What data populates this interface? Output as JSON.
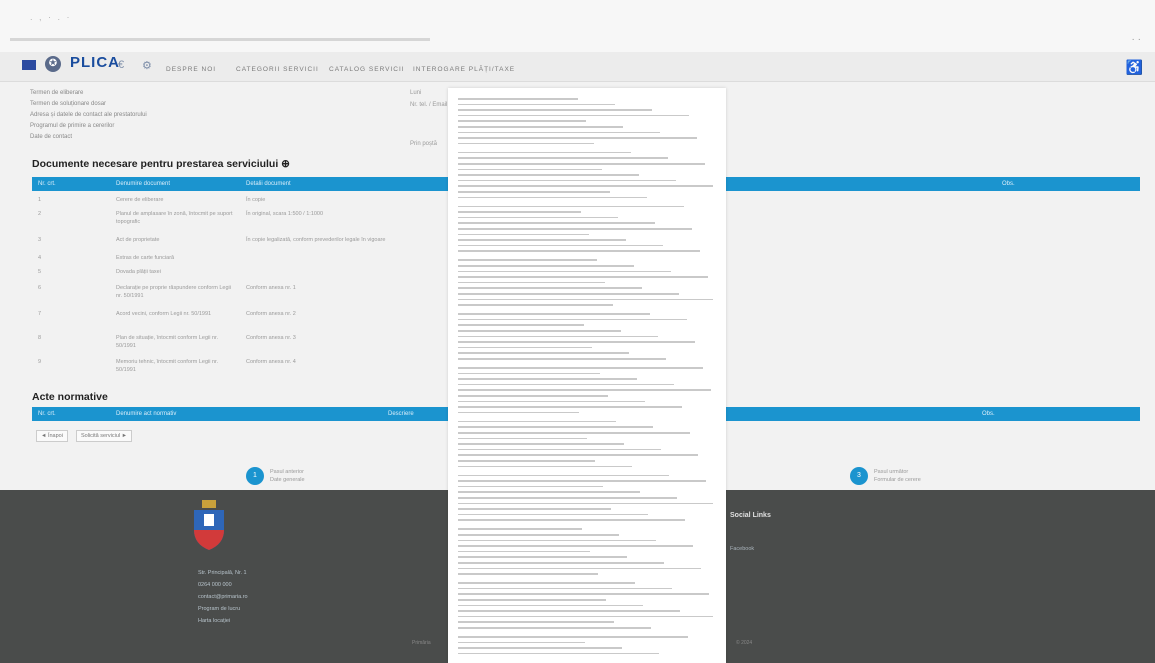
{
  "browser": {
    "scan_marks": ". , · . ·",
    "window_controls": "·  ·"
  },
  "header": {
    "logo": "PLICA",
    "nav_icon_1": "€",
    "nav_icon_2": "⚙",
    "nav": [
      "DESPRE NOI",
      "CATEGORII SERVICII",
      "CATALOG SERVICII",
      "INTEROGARE PLĂȚI/TAXE"
    ],
    "accessibility_symbol": "♿"
  },
  "service_info": {
    "rows": [
      "Termen de eliberare",
      "Termen de soluționare dosar",
      "Adresa și datele de contact ale prestatorului",
      "Programul de primire a cererilor",
      "Date de contact"
    ],
    "side_notes": [
      "Luni",
      "Nr. tel. / Email",
      "Prin poștă"
    ]
  },
  "documents": {
    "title": "Documente necesare pentru prestarea serviciului ⊕",
    "headers": [
      "Nr. crt.",
      "Denumire document",
      "Detalii document",
      "Obs."
    ],
    "rows": [
      {
        "nr": "1",
        "name": "Cerere de eliberare",
        "detail": "În copie"
      },
      {
        "nr": "2",
        "name": "Planul de amplasare în zonă, întocmit pe suport topografic",
        "detail": "În original, scara 1:500 / 1:1000"
      },
      {
        "nr": "3",
        "name": "Act de proprietate",
        "detail": "În copie legalizată, conform prevederilor legale în vigoare"
      },
      {
        "nr": "4",
        "name": "Extras de carte funciară",
        "detail": ""
      },
      {
        "nr": "5",
        "name": "Dovada plății taxei",
        "detail": ""
      },
      {
        "nr": "6",
        "name": "Declarație pe proprie răspundere conform Legii nr. 50/1991",
        "detail": "Conform anexa nr. 1"
      },
      {
        "nr": "7",
        "name": "Acord vecini, conform Legii nr. 50/1991",
        "detail": "Conform anexa nr. 2"
      },
      {
        "nr": "8",
        "name": "Plan de situație, întocmit conform Legii nr. 50/1991",
        "detail": "Conform anexa nr. 3"
      },
      {
        "nr": "9",
        "name": "Memoriu tehnic, întocmit conform Legii nr. 50/1991",
        "detail": "Conform anexa nr. 4"
      }
    ]
  },
  "acte_normative": {
    "title": "Acte normative",
    "headers": [
      "Nr. crt.",
      "Denumire act normativ",
      "Descriere",
      "Obs."
    ],
    "buttons": [
      "◄ Înapoi",
      "Solicită serviciul ►"
    ]
  },
  "steps": [
    {
      "num": "1",
      "line1": "Pasul anterior",
      "line2": "Date generale"
    },
    {
      "num": "3",
      "line1": "Pasul următor",
      "line2": "Formular de cerere"
    }
  ],
  "footer": {
    "contacts": [
      "Str. Principală, Nr. 1",
      "0264 000 000",
      "contact@primaria.ro",
      "Program de lucru",
      "Harta locației"
    ],
    "social_title": "Social Links",
    "social_link": "Facebook",
    "copyright": "Primăria",
    "year": "© 2024"
  }
}
